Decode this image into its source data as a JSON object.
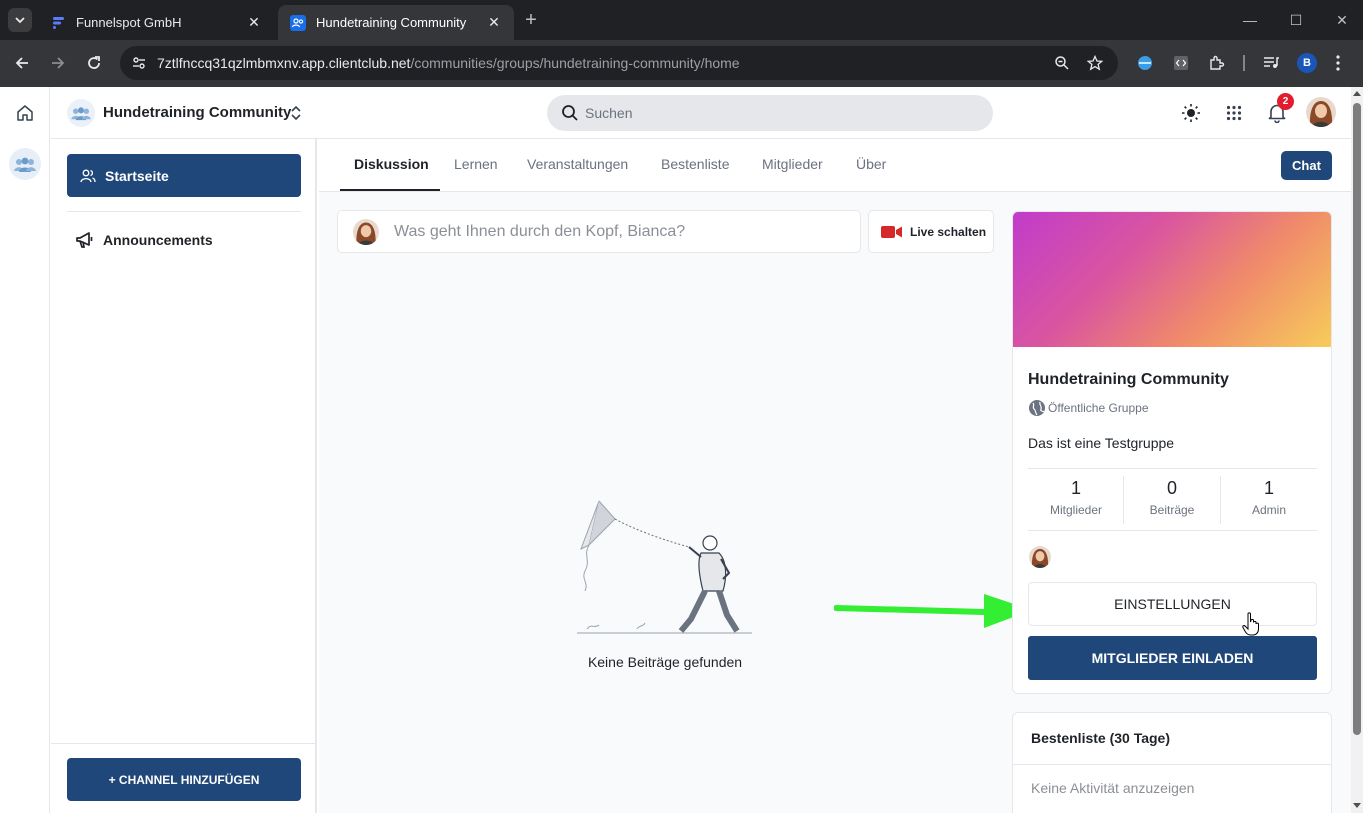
{
  "browser": {
    "tabs": [
      {
        "title": "Funnelspot GmbH",
        "active": false
      },
      {
        "title": "Hundetraining Community",
        "active": true
      }
    ],
    "url_host": "7ztlfnccq31qzlmbmxnv.app.clientclub.net",
    "url_path": "/communities/groups/hundetraining-community/home",
    "profile_initial": "B"
  },
  "header": {
    "community_name": "Hundetraining Community",
    "search_placeholder": "Suchen",
    "notification_count": "2"
  },
  "sidebar": {
    "active_item": "Startseite",
    "items": [
      {
        "label": "Announcements",
        "icon": "megaphone-icon"
      }
    ],
    "add_channel_label": "+ CHANNEL HINZUFÜGEN"
  },
  "main": {
    "tabs": [
      "Diskussion",
      "Lernen",
      "Veranstaltungen",
      "Bestenliste",
      "Mitglieder",
      "Über"
    ],
    "active_tab": "Diskussion",
    "chat_label": "Chat",
    "composer_placeholder": "Was geht Ihnen durch den Kopf, Bianca?",
    "live_label": "Live schalten",
    "empty_text": "Keine Beiträge gefunden"
  },
  "group_card": {
    "title": "Hundetraining Community",
    "type": "Öffentliche Gruppe",
    "description": "Das ist eine Testgruppe",
    "stats": [
      {
        "value": "1",
        "label": "Mitglieder"
      },
      {
        "value": "0",
        "label": "Beiträge"
      },
      {
        "value": "1",
        "label": "Admin"
      }
    ],
    "settings_label": "EINSTELLUNGEN",
    "invite_label": "MITGLIEDER EINLADEN"
  },
  "leaderboard": {
    "title": "Bestenliste (30 Tage)",
    "empty": "Keine Aktivität anzuzeigen"
  },
  "colors": {
    "primary": "#1f477a",
    "badge": "#e11d2e",
    "annotation_arrow": "#33ee33"
  }
}
